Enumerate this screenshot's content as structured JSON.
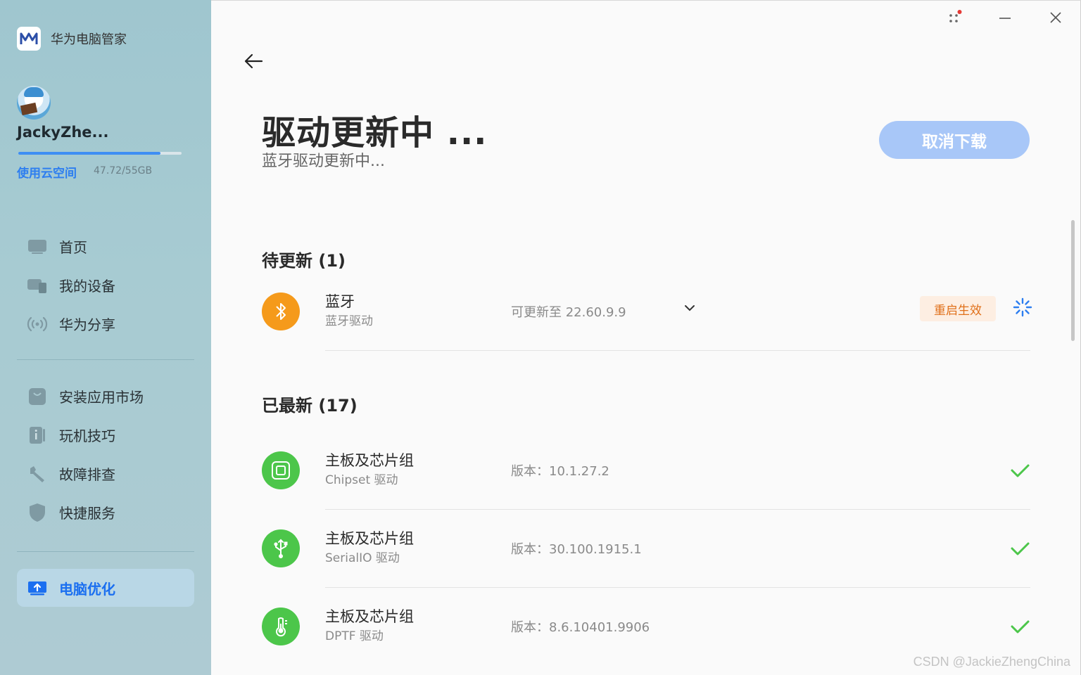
{
  "app": {
    "name": "华为电脑管家"
  },
  "user": {
    "name": "JackyZhe...",
    "cloud_link": "使用云空间",
    "cloud_usage": "47.72/55GB",
    "cloud_fraction": 0.87
  },
  "nav": {
    "group1": [
      {
        "label": "首页",
        "icon": "monitor-icon"
      },
      {
        "label": "我的设备",
        "icon": "devices-icon"
      },
      {
        "label": "华为分享",
        "icon": "share-icon"
      }
    ],
    "group2": [
      {
        "label": "安装应用市场",
        "icon": "shopping-bag-icon"
      },
      {
        "label": "玩机技巧",
        "icon": "info-icon"
      },
      {
        "label": "故障排查",
        "icon": "wrench-icon"
      },
      {
        "label": "快捷服务",
        "icon": "shield-icon"
      }
    ],
    "active": {
      "label": "电脑优化",
      "icon": "pc-optimize-icon"
    }
  },
  "header": {
    "title": "驱动更新中 ...",
    "subtitle": "蓝牙驱动更新中...",
    "cancel_label": "取消下载"
  },
  "pending": {
    "title": "待更新 (1)",
    "items": [
      {
        "name": "蓝牙",
        "desc": "蓝牙驱动",
        "version": "可更新至 22.60.9.9",
        "badge": "重启生效",
        "icon": "bluetooth-icon",
        "color": "#f59a1b"
      }
    ]
  },
  "updated": {
    "title": "已最新 (17)",
    "items": [
      {
        "name": "主板及芯片组",
        "desc": "Chipset 驱动",
        "version": "版本：10.1.27.2",
        "icon": "chip-icon",
        "color": "#4cc64a"
      },
      {
        "name": "主板及芯片组",
        "desc": "SerialIO 驱动",
        "version": "版本：30.100.1915.1",
        "icon": "usb-icon",
        "color": "#4cc64a"
      },
      {
        "name": "主板及芯片组",
        "desc": "DPTF 驱动",
        "version": "版本：8.6.10401.9906",
        "icon": "thermometer-icon",
        "color": "#4cc64a"
      }
    ]
  },
  "watermark": "CSDN @JackieZhengChina"
}
